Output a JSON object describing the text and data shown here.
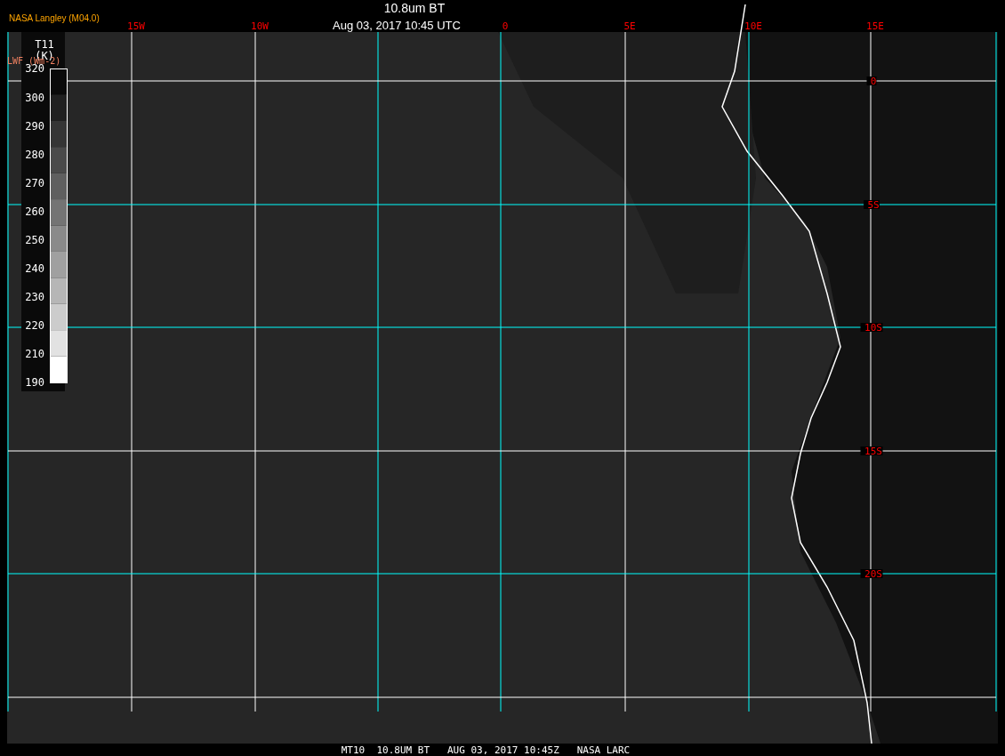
{
  "header": {
    "source": "NASA Langley (M04.0)",
    "title": "10.8um BT",
    "datetime": "Aug 03, 2017 10:45 UTC"
  },
  "legend": {
    "title": "T11",
    "unit": "(K)",
    "secondary_label": "LWF (Wm-2)",
    "ticks": [
      "320",
      "300",
      "290",
      "280",
      "270",
      "260",
      "250",
      "240",
      "230",
      "220",
      "210",
      "190"
    ],
    "steps": [
      {
        "color": "#0a0a0a"
      },
      {
        "color": "#202020"
      },
      {
        "color": "#353535"
      },
      {
        "color": "#4a4a4a"
      },
      {
        "color": "#5f5f5f"
      },
      {
        "color": "#747474"
      },
      {
        "color": "#8a8a8a"
      },
      {
        "color": "#a0a0a0"
      },
      {
        "color": "#b6b6b6"
      },
      {
        "color": "#cccccc"
      },
      {
        "color": "#e2e2e2"
      },
      {
        "color": "#ffffff"
      }
    ]
  },
  "map": {
    "longitude_labels": [
      "15W",
      "10W",
      "0",
      "5E",
      "10E",
      "15E"
    ],
    "latitude_labels": [
      "0",
      "5S",
      "10S",
      "15S",
      "20S"
    ]
  },
  "footer": {
    "caption": "MT10  10.8UM BT   AUG 03, 2017 10:45Z   NASA LARC"
  }
}
